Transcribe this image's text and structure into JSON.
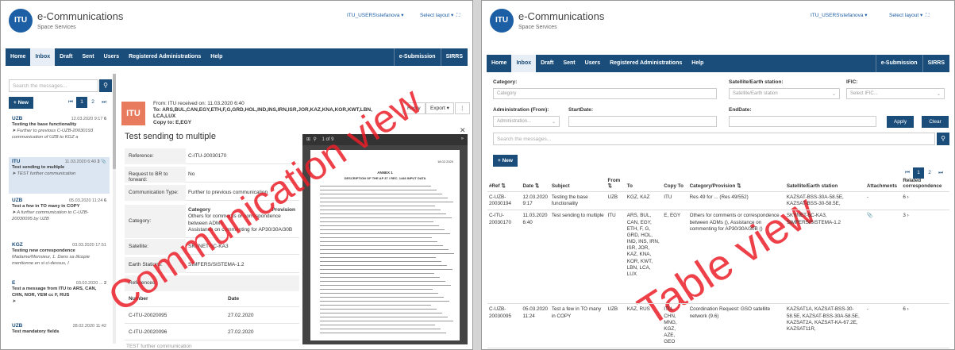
{
  "brand": {
    "name": "e-Communications",
    "sub": "Space Services",
    "logo": "ITU"
  },
  "user": "ITU_USERS\\stefanova",
  "select_layout": "Select layout",
  "nav": [
    "Home",
    "Inbox",
    "Draft",
    "Sent",
    "Users",
    "Registered Administrations",
    "Help"
  ],
  "nav_right": [
    "e-Submission",
    "SIRRS"
  ],
  "left": {
    "search_placeholder": "Search the messages...",
    "new_label": "+ New",
    "pages": [
      "⏮",
      "1",
      "2",
      "⏭"
    ],
    "messages": [
      {
        "sender": "UZB",
        "date": "12.03.2020 9:17",
        "badge": "6",
        "subject": "Testing the base functionality",
        "preview": "➤ Further to previous C-UZB-20030193 communication of UZB to KGZ a"
      },
      {
        "sender": "ITU",
        "date": "11.03.2020 6:40",
        "badge": "3",
        "subject": "Test sending to multiple",
        "preview": "➤ TEST further communication"
      },
      {
        "sender": "UZB",
        "date": "05.03.2020 11:24",
        "badge": "6",
        "subject": "Test a few in TO many in COPY",
        "preview": "➤ A further communication to C-UZB-20030095 by UZB"
      },
      {
        "sender": "KGZ",
        "date": "03.03.2020 17:51",
        "badge": "",
        "subject": "Testing new correspondence",
        "preview": "Madame/Monsieur, 1. Dans sa lilcopie mentionne en si ci-dessus, l"
      },
      {
        "sender": "E",
        "date": "03.03.2020 ...",
        "badge": "2",
        "subject": "Test a message from ITU to ARS, CAN, CHN, NOR, YEM cc F, RUS",
        "preview": "➤"
      },
      {
        "sender": "UZB",
        "date": "28.02.2020 11:42",
        "badge": "",
        "subject": "Test mandatory fields",
        "preview": ""
      }
    ],
    "detail": {
      "icon": "ITU",
      "from": "From: ITU received on: 11.03.2020 6:40",
      "to": "To: ARS,BUL,CAN,EGY,ETH,F,G,GRD,HOL,IND,INS,IRN,ISR,JOR,KAZ,KNA,KOR,KWT,LBN,",
      "to2": "LCA,LUX",
      "copy": "Copy to: E,EGY",
      "reply": "Reply",
      "export": "Export ▾",
      "more": "⋮",
      "subject": "Test sending to multiple",
      "reference_label": "Reference:",
      "reference": "C-ITU-20030170",
      "request_label": "Request to BR to forward:",
      "request": "No",
      "comm_type_label": "Communication Type:",
      "comm_type": "Further to previous communication",
      "category_label": "Category:",
      "category_head": "Category",
      "category_head2": "Provision",
      "category_1": "Others for comments or correspondence between ADMs",
      "category_2": "Assistance on commenting for AP30/30A/30B",
      "sat_label": "Satellite:",
      "sat": "SKYNET-5C-KA3",
      "earth_label": "Earth Stations:",
      "earth": "SIMFERS/SISTEMA-1.2",
      "refs_label": "References:",
      "refs_cols": [
        "Number",
        "Date"
      ],
      "refs": [
        [
          "C-ITU-20020095",
          "27.02.2020"
        ],
        [
          "C-ITU-20020096",
          "27.02.2020"
        ]
      ],
      "footer": "TEST further communication",
      "viewer_page": "1 of 9",
      "viewer_close": "✕",
      "doc_date": "18.02.2020",
      "doc_title": "ANNEX 1",
      "doc_sub": "DESCRIPTION OF THE AP 37 / REC. 1448 INPUT DATA"
    },
    "watermark": "Communication view"
  },
  "right": {
    "labels": {
      "category": "Category:",
      "sat": "Satellite/Earth station:",
      "ific": "IFIC:",
      "admin": "Administration (From):",
      "start": "StartDate:",
      "end": "EndDate:"
    },
    "placeholders": {
      "category": "Category",
      "sat": "Satellite/Earth station",
      "ific": "Select IFIC...",
      "admin": "Administration...",
      "search": "Search the messages..."
    },
    "apply": "Apply",
    "clear": "Clear",
    "new_label": "+ New",
    "pages": [
      "⏮",
      "1",
      "2",
      "⏭"
    ],
    "columns": [
      "#Ref ⇅",
      "Date ⇅",
      "Subject",
      "From ⇅",
      "To",
      "Copy To",
      "Category/Provision ⇅",
      "Satellite/Earth station",
      "Attachments",
      "Related correspondence"
    ],
    "rows": [
      [
        "C-UZB-20030194",
        "12.03.2020 9:17",
        "Testing the base functionality",
        "UZB",
        "KGZ, KAZ",
        "ITU",
        "Res 49 for ... (Res 49/552)",
        "KAZSAT-BSS-30A-58.5E, KAZSAT-BSS-30-58.5E,",
        "-",
        "6 ›"
      ],
      [
        "C-ITU-20030170",
        "11.03.2020 6:40",
        "Test sending to multiple",
        "ITU",
        "ARS, BUL, CAN, EGY, ETH, F, G, GRD, HOL, IND, INS, IRN, ISR, JOR, KAZ, KNA, KOR, KWT, LBN, LCA, LUX",
        "E, EGY",
        "Others for comments or correspondence between ADMs (), Assistance on commenting for AP30/30A/30B ()",
        "SKYNET-5C-KA3, SIMFERS/SISTEMA-1.2",
        "📎",
        "3 ›"
      ],
      [
        "C-UZB-20030095",
        "05.03.2020 11:24",
        "Test a few in TO many in COPY",
        "UZB",
        "KAZ, RUS",
        "ITU, CHN, MNG, KGZ, AZE, GEO",
        "Coordination Request: GSO satellite network (9.6)",
        "KAZSAT1A, KAZSAT-BSS-30-58.5E, KAZSAT-BSS-30A-58.5E, KAZSAT2A, KAZSAT-KA-67.2E, KAZSAT11R,",
        "-",
        "6 ›"
      ]
    ],
    "watermark": "Table view"
  },
  "colors": {
    "nav": "#1a4d7a",
    "accent": "#1d5fa5",
    "watermark": "#eb1e28",
    "itu_icon": "#e87a5d"
  }
}
